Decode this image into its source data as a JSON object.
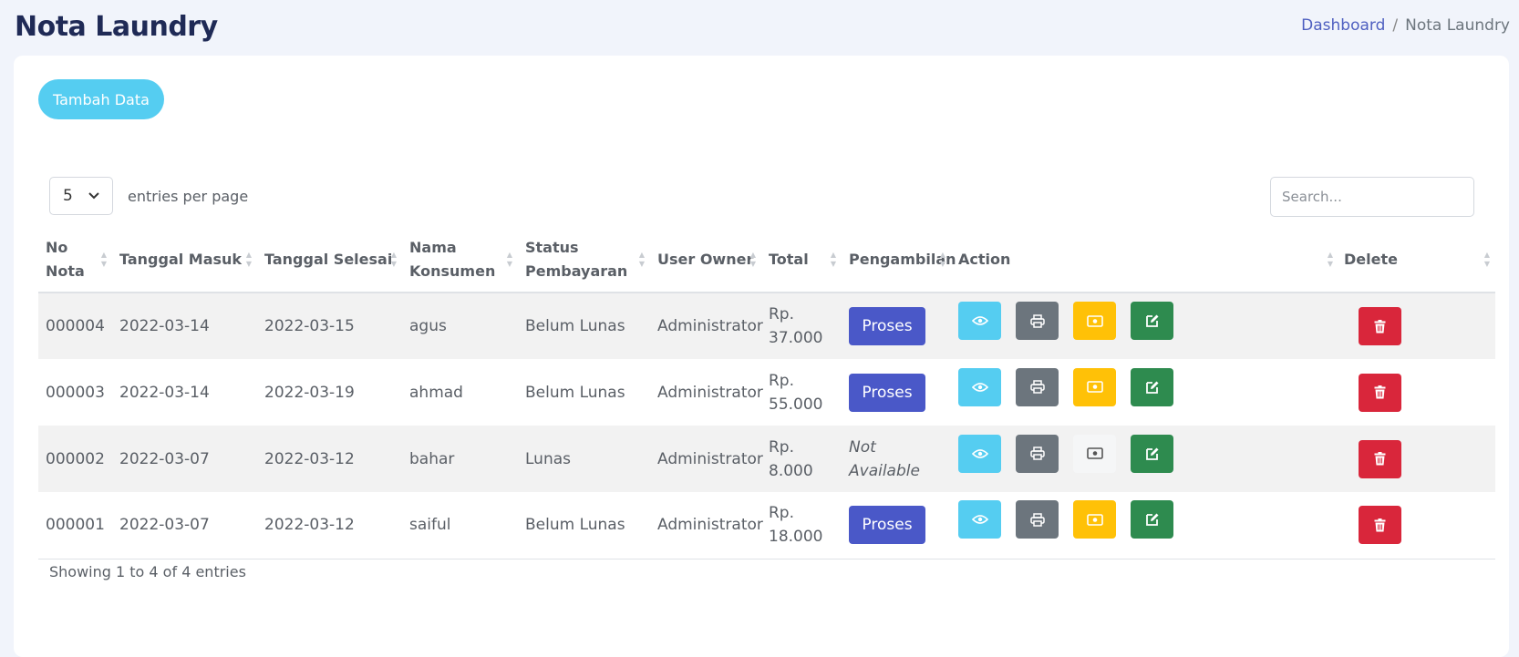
{
  "page": {
    "title": "Nota Laundry"
  },
  "breadcrumb": {
    "home": "Dashboard",
    "separator": "/",
    "current": "Nota Laundry"
  },
  "toolbar": {
    "add_label": "Tambah Data"
  },
  "table_controls": {
    "entries_value": "5",
    "entries_label": "entries per page",
    "search_placeholder": "Search..."
  },
  "table": {
    "headers": [
      "No Nota",
      "Tanggal Masuk",
      "Tanggal Selesai",
      "Nama Konsumen",
      "Status Pembayaran",
      "User Owner",
      "Total",
      "Pengambilan",
      "Action",
      "Delete"
    ],
    "rows": [
      {
        "no": "000004",
        "masuk": "2022-03-14",
        "selesai": "2022-03-15",
        "nama": "agus",
        "status": "Belum Lunas",
        "owner": "Administrator",
        "total": "Rp. 37.000",
        "pengambilan": "Proses",
        "pay_enabled": true
      },
      {
        "no": "000003",
        "masuk": "2022-03-14",
        "selesai": "2022-03-19",
        "nama": "ahmad",
        "status": "Belum Lunas",
        "owner": "Administrator",
        "total": "Rp. 55.000",
        "pengambilan": "Proses",
        "pay_enabled": true
      },
      {
        "no": "000002",
        "masuk": "2022-03-07",
        "selesai": "2022-03-12",
        "nama": "bahar",
        "status": "Lunas",
        "owner": "Administrator",
        "total": "Rp. 8.000",
        "pengambilan": "Not Available",
        "pay_enabled": false
      },
      {
        "no": "000001",
        "masuk": "2022-03-07",
        "selesai": "2022-03-12",
        "nama": "saiful",
        "status": "Belum Lunas",
        "owner": "Administrator",
        "total": "Rp. 18.000",
        "pengambilan": "Proses",
        "pay_enabled": true
      }
    ]
  },
  "footer": {
    "info": "Showing 1 to 4 of 4 entries"
  },
  "colors": {
    "title": "#1f2a56",
    "add_button": "#55cdf1",
    "proses": "#4a58c8",
    "view": "#55cdf1",
    "print": "#6c757d",
    "pay": "#ffc107",
    "edit": "#2e8b4f",
    "delete": "#d9263b"
  },
  "icons": {
    "view": "eye-icon",
    "print": "printer-icon",
    "pay": "money-icon",
    "edit": "edit-icon",
    "delete": "trash-icon",
    "entries": "chevron-down-icon"
  }
}
